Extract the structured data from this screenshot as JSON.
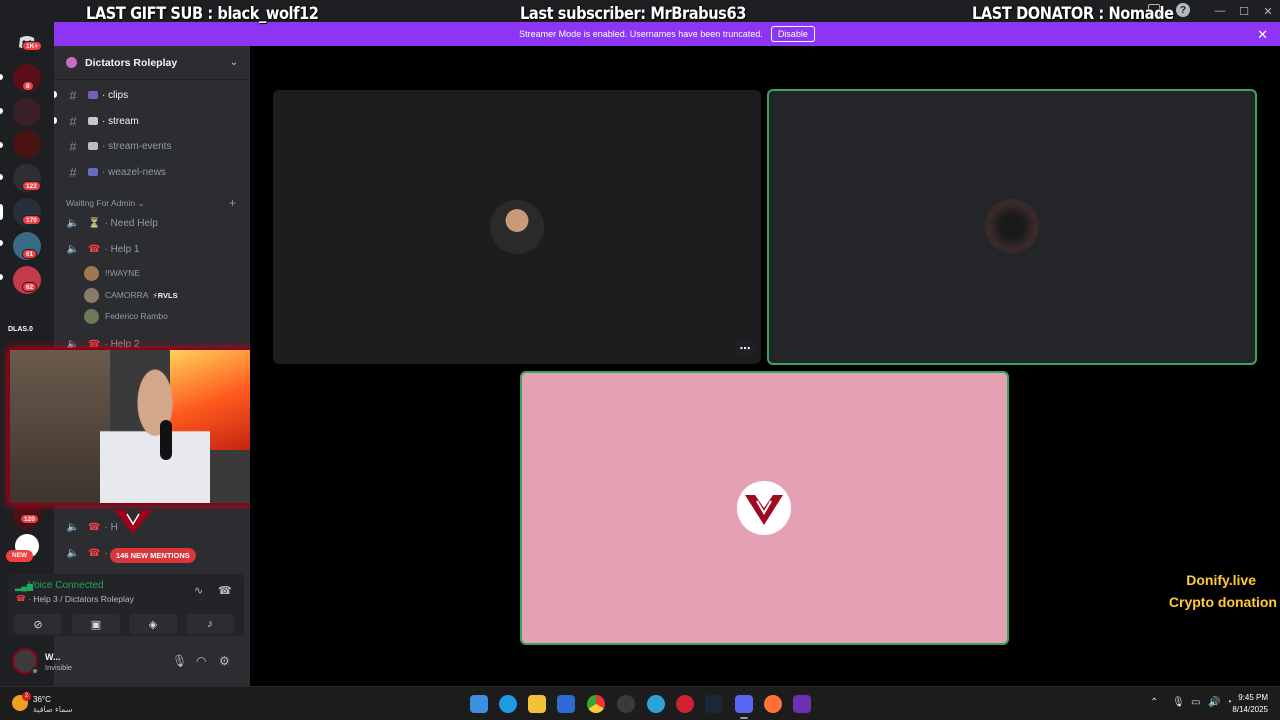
{
  "overlay": {
    "last_gift_sub": "LAST GIFT SUB : black_wolf12",
    "last_subscriber": "Last subscriber: MrBrabus63",
    "last_donator": "LAST DONATOR : Nomade"
  },
  "window": {
    "minimize": "—",
    "maximize": "☐",
    "close": "✕",
    "help": "?"
  },
  "banner": {
    "message": "Streamer Mode is enabled. Usernames have been truncated.",
    "disable_label": "Disable",
    "close_icon": "✕",
    "color": "#8c35f5"
  },
  "rail": {
    "dm_badge": "1K+",
    "badges": [
      "8",
      "122",
      "170",
      "61",
      "62",
      "120"
    ],
    "dlas_label": "DLAS.0",
    "new_label": "NEW"
  },
  "server": {
    "name": "Dictators Roleplay",
    "chevron": "⌄"
  },
  "channels": [
    {
      "prefix": "#",
      "name": "· clips",
      "unread": true
    },
    {
      "prefix": "#",
      "name": "· stream",
      "unread": true
    },
    {
      "prefix": "#",
      "name": "· stream-events",
      "unread": false
    },
    {
      "prefix": "#",
      "name": "· weazel-news",
      "unread": false
    }
  ],
  "category": {
    "name": "Waiting For Admin ⌄",
    "plus": "+"
  },
  "voice_channels": [
    {
      "name": "· Need Help",
      "icon": "⏳"
    },
    {
      "name": "· Help 1",
      "icon": "☎"
    },
    {
      "name": "· Help 2",
      "icon": "☎"
    }
  ],
  "members": [
    {
      "name": "!!WAYNE",
      "tag": ""
    },
    {
      "name": "CAMORRA",
      "tag": "⚡RVLS"
    },
    {
      "name": "Federico Rambo",
      "tag": ""
    }
  ],
  "bottom_voice": [
    {
      "name": "· H"
    },
    {
      "name": "·"
    }
  ],
  "mentions_badge": "146 NEW MENTIONS",
  "voice_connected": {
    "status": "Voice Connected",
    "location": "· Help 3 / Dictators Roleplay",
    "buttons": [
      "camera-off",
      "screen-share",
      "activity",
      "soundboard"
    ]
  },
  "user": {
    "name": "W...",
    "status": "Invisible"
  },
  "donify": {
    "line1": "Donify.live",
    "line2": "Crypto donation"
  },
  "taskbar": {
    "weather_temp": "36°C",
    "weather_desc": "سماء صافية",
    "weather_badge": "2",
    "time": "9:45 PM",
    "date": "8/14/2025"
  },
  "colors": {
    "accent_purple": "#8c35f5",
    "speaking_green": "#3ba55c",
    "tile_pink": "#e3a1b3",
    "danger_red": "#f23f43"
  }
}
